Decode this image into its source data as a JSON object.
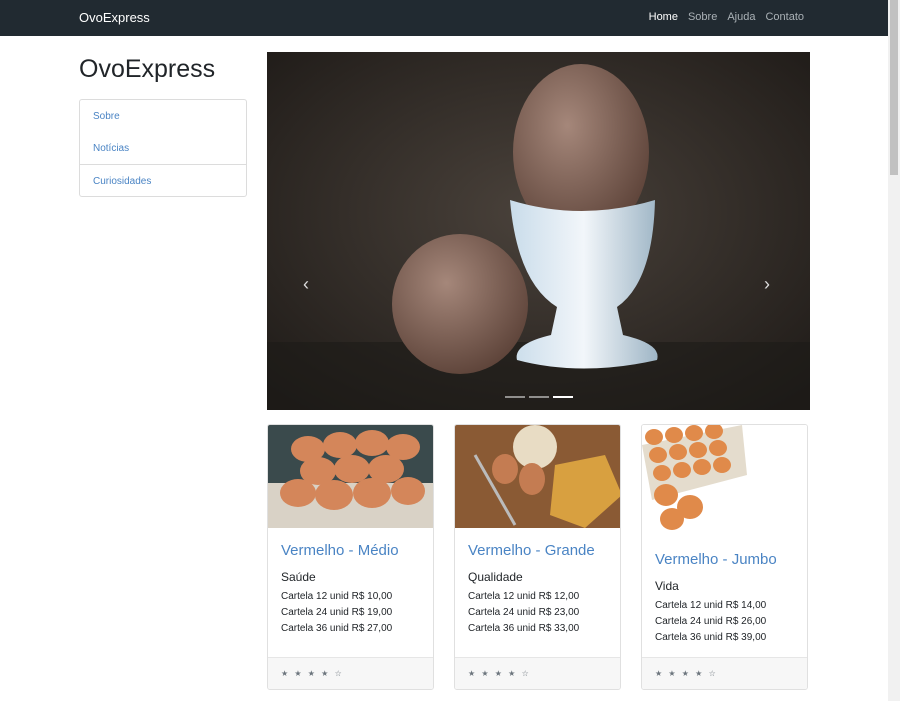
{
  "navbar": {
    "brand": "OvoExpress",
    "links": [
      "Home",
      "Sobre",
      "Ajuda",
      "Contato"
    ],
    "active": "Home"
  },
  "sidebar": {
    "title": "OvoExpress",
    "items": [
      {
        "label": "Sobre"
      },
      {
        "label": "Notícias"
      },
      {
        "label": "Curiosidades"
      }
    ]
  },
  "carousel": {
    "prev_icon": "chevron-left-icon",
    "next_icon": "chevron-right-icon",
    "prev_glyph": "‹",
    "next_glyph": "›",
    "slide_count": 3,
    "active_slide": 3
  },
  "products": [
    {
      "title": "Vermelho - Médio",
      "subtitle": "Saúde",
      "lines": [
        "Cartela 12 unid R$ 10,00",
        "Cartela 24 unid R$ 19,00",
        "Cartela 36 unid R$ 27,00"
      ],
      "rating": "★ ★ ★ ★ ☆"
    },
    {
      "title": "Vermelho - Grande",
      "subtitle": "Qualidade",
      "lines": [
        "Cartela 12 unid R$ 12,00",
        "Cartela 24 unid R$ 23,00",
        "Cartela 36 unid R$ 33,00"
      ],
      "rating": "★ ★ ★ ★ ☆"
    },
    {
      "title": "Vermelho - Jumbo",
      "subtitle": "Vida",
      "lines": [
        "Cartela 12 unid R$ 14,00",
        "Cartela 24 unid R$ 26,00",
        "Cartela 36 unid R$ 39,00"
      ],
      "rating": "★ ★ ★ ★ ☆"
    }
  ],
  "colors": {
    "navbar": "#212a31",
    "link": "#4a84c4",
    "egg": "#8a6a5a"
  }
}
